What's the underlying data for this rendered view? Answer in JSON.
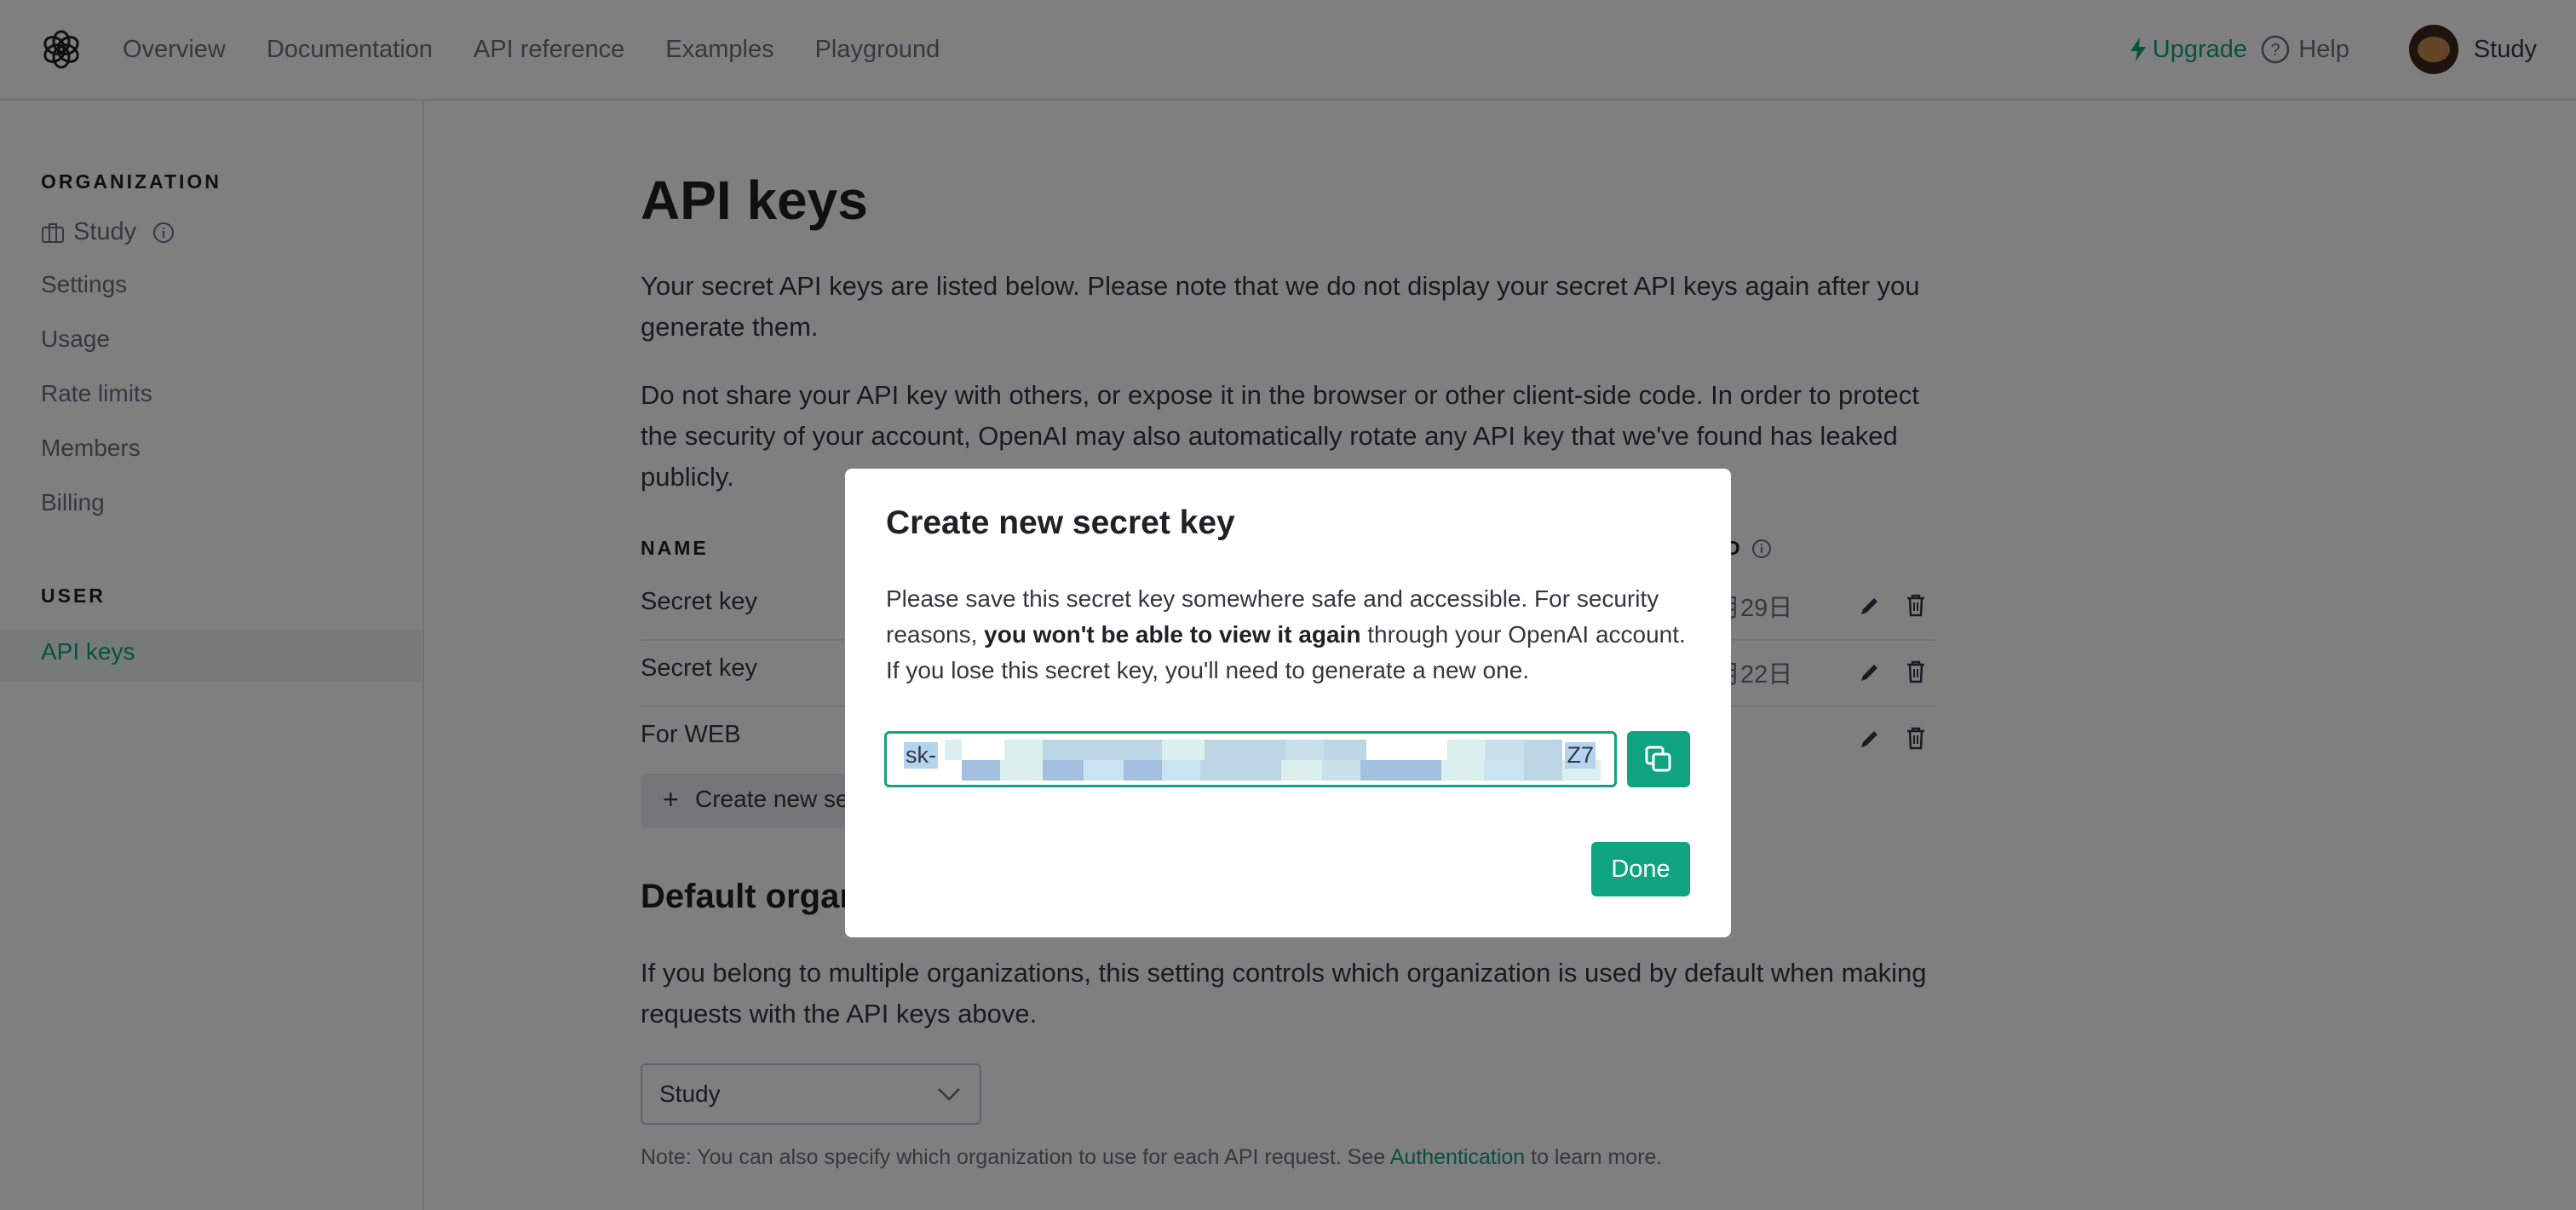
{
  "nav": {
    "links": [
      "Overview",
      "Documentation",
      "API reference",
      "Examples",
      "Playground"
    ],
    "upgrade_label": "Upgrade",
    "help_label": "Help",
    "user_name": "Study"
  },
  "sidebar": {
    "org_heading": "ORGANIZATION",
    "org_name": "Study",
    "items": [
      "Settings",
      "Usage",
      "Rate limits",
      "Members",
      "Billing"
    ],
    "user_heading": "USER",
    "active_item": "API keys"
  },
  "main": {
    "title": "API keys",
    "intro": "Your secret API keys are listed below. Please note that we do not display your secret API keys again after you generate them.",
    "warning": "Do not share your API key with others, or expose it in the browser or other client-side code. In order to protect the security of your account, OpenAI may also automatically rotate any API key that we've found has leaked publicly.",
    "table": {
      "col_name": "NAME",
      "col_created": "D",
      "rows": [
        {
          "name": "Secret key",
          "created": "月29日"
        },
        {
          "name": "Secret key",
          "created": "月22日"
        },
        {
          "name": "For WEB",
          "created": ""
        }
      ]
    },
    "create_button": "Create new se",
    "default_org_heading": "Default organ",
    "default_org_text": "If you belong to multiple organizations, this setting controls which organization is used by default when making requests with the API keys above.",
    "org_select_value": "Study",
    "note_prefix": "Note: You can also specify which organization to use for each API request. See ",
    "note_link": "Authentication",
    "note_suffix": " to learn more."
  },
  "modal": {
    "title": "Create new secret key",
    "text_1": "Please save this secret key somewhere safe and accessible. For security reasons, ",
    "text_bold": "you won't be able to view it again",
    "text_2": " through your OpenAI account. If you lose this secret key, you'll need to generate a new one.",
    "key_prefix": "sk-",
    "key_suffix": "Z7",
    "done_label": "Done"
  },
  "colors": {
    "accent": "#10a37f",
    "overlay": "rgba(0,0,0,0.5)",
    "text": "#353740",
    "muted": "#6e6e80"
  }
}
